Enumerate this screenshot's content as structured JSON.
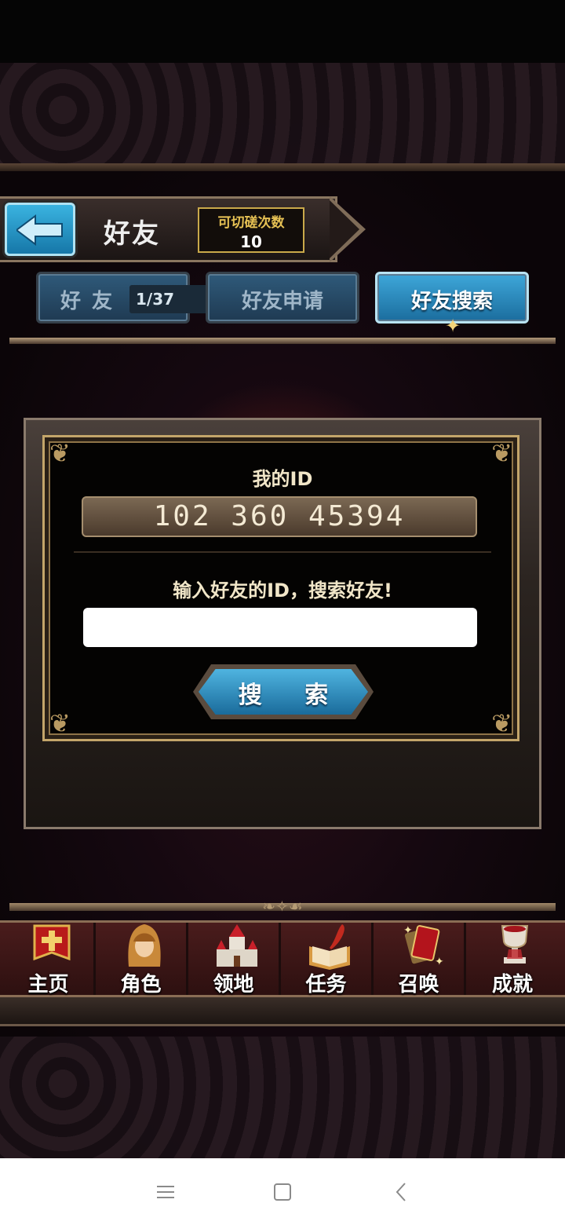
{
  "header": {
    "title": "好友",
    "poke_label": "可切磋次数",
    "poke_count": "10"
  },
  "tabs": [
    {
      "label": "好友",
      "count": "1/37",
      "active": false
    },
    {
      "label": "好友申请",
      "active": false
    },
    {
      "label": "好友搜索",
      "active": true
    }
  ],
  "panel": {
    "my_id_label": "我的ID",
    "my_id_value": "102 360 45394",
    "search_prompt": "输入好友的ID，搜索好友!",
    "search_input_value": "",
    "search_button_label": "搜 索"
  },
  "bottom_nav": [
    {
      "label": "主页",
      "icon": "banner-cross-icon"
    },
    {
      "label": "角色",
      "icon": "hooded-character-icon"
    },
    {
      "label": "领地",
      "icon": "castle-icon"
    },
    {
      "label": "任务",
      "icon": "quest-book-icon"
    },
    {
      "label": "召唤",
      "icon": "summon-cards-icon"
    },
    {
      "label": "成就",
      "icon": "trophy-icon"
    }
  ],
  "system_nav": [
    "menu-icon",
    "home-square-icon",
    "back-chevron-icon"
  ],
  "colors": {
    "accent_blue": "#2a8fc7",
    "gold": "#c9a94a",
    "nav_red": "#4a1c1c"
  }
}
